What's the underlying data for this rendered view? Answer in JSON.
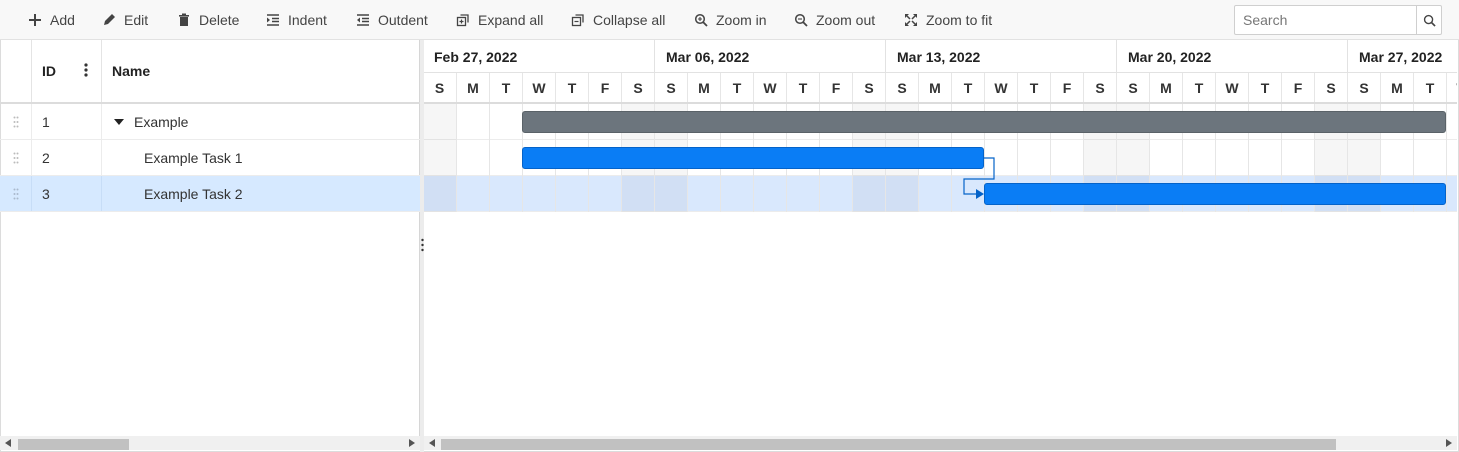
{
  "toolbar": {
    "add": "Add",
    "edit": "Edit",
    "delete": "Delete",
    "indent": "Indent",
    "outdent": "Outdent",
    "expand_all": "Expand all",
    "collapse_all": "Collapse all",
    "zoom_in": "Zoom in",
    "zoom_out": "Zoom out",
    "zoom_to_fit": "Zoom to fit",
    "search_placeholder": "Search",
    "icons": [
      "plus-icon",
      "pencil-icon",
      "trash-icon",
      "indent-icon",
      "outdent-icon",
      "expand-all-icon",
      "collapse-all-icon",
      "zoom-in-icon",
      "zoom-out-icon",
      "zoom-to-fit-icon",
      "search-icon"
    ]
  },
  "grid": {
    "columns": {
      "id": "ID",
      "name": "Name"
    },
    "rows": [
      {
        "id": "1",
        "name": "Example",
        "summary": true,
        "expanded": true,
        "selected": false
      },
      {
        "id": "2",
        "name": "Example Task 1",
        "summary": false,
        "selected": false
      },
      {
        "id": "3",
        "name": "Example Task 2",
        "summary": false,
        "selected": true
      }
    ]
  },
  "timeline": {
    "weeks": [
      "Feb 27, 2022",
      "Mar 06, 2022",
      "Mar 13, 2022",
      "Mar 20, 2022",
      "Mar 27, 2022"
    ],
    "day_letters": [
      "S",
      "M",
      "T",
      "W",
      "T",
      "F",
      "S"
    ],
    "tasks": [
      {
        "id": "1",
        "start": "2022-03-02",
        "end": "2022-03-30",
        "type": "summary"
      },
      {
        "id": "2",
        "start": "2022-03-02",
        "end": "2022-03-16",
        "type": "task"
      },
      {
        "id": "3",
        "start": "2022-03-16",
        "end": "2022-03-30",
        "type": "task"
      }
    ],
    "dependencies": [
      {
        "from": "2",
        "to": "3"
      }
    ]
  },
  "colors": {
    "summary_bar": "#6c757d",
    "task_bar": "#0a7df5",
    "selected_row": "#d6e9ff",
    "accent": "#0a7df5"
  }
}
